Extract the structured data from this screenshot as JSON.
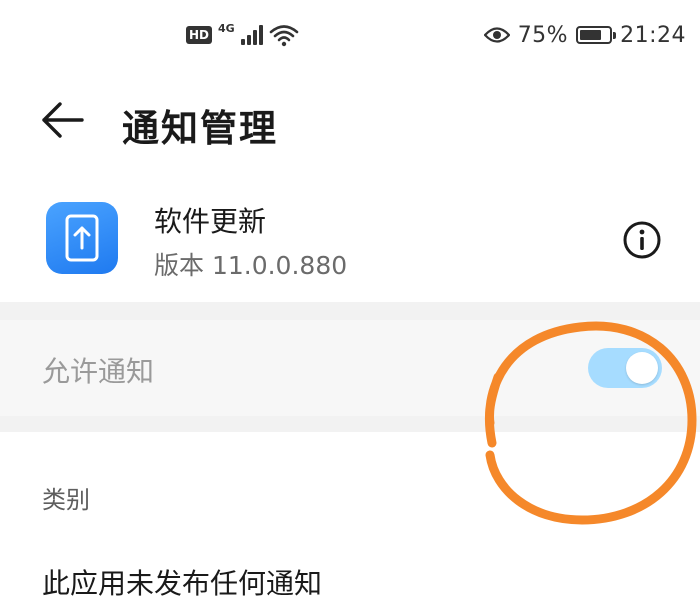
{
  "status_bar": {
    "hd_badge": "HD",
    "network_type": "4G",
    "icons": [
      "signal-icon",
      "wifi-icon",
      "eye-icon",
      "battery-icon"
    ],
    "battery_percent_text": "75%",
    "battery_level": 0.75,
    "time": "21:24"
  },
  "header": {
    "back_icon": "arrow-left-icon",
    "title": "通知管理"
  },
  "app_info": {
    "icon": "phone-update-icon",
    "name": "软件更新",
    "version": "版本 11.0.0.880",
    "info_icon": "info-icon"
  },
  "allow_notifications": {
    "label": "允许通知",
    "enabled": true
  },
  "category": {
    "label": "类别",
    "empty_message": "此应用未发布任何通知"
  },
  "colors": {
    "toggle_track": "#a6dcff",
    "app_icon": "#2f8cff",
    "annotation": "#f5882a",
    "band": "#f2f2f2"
  }
}
